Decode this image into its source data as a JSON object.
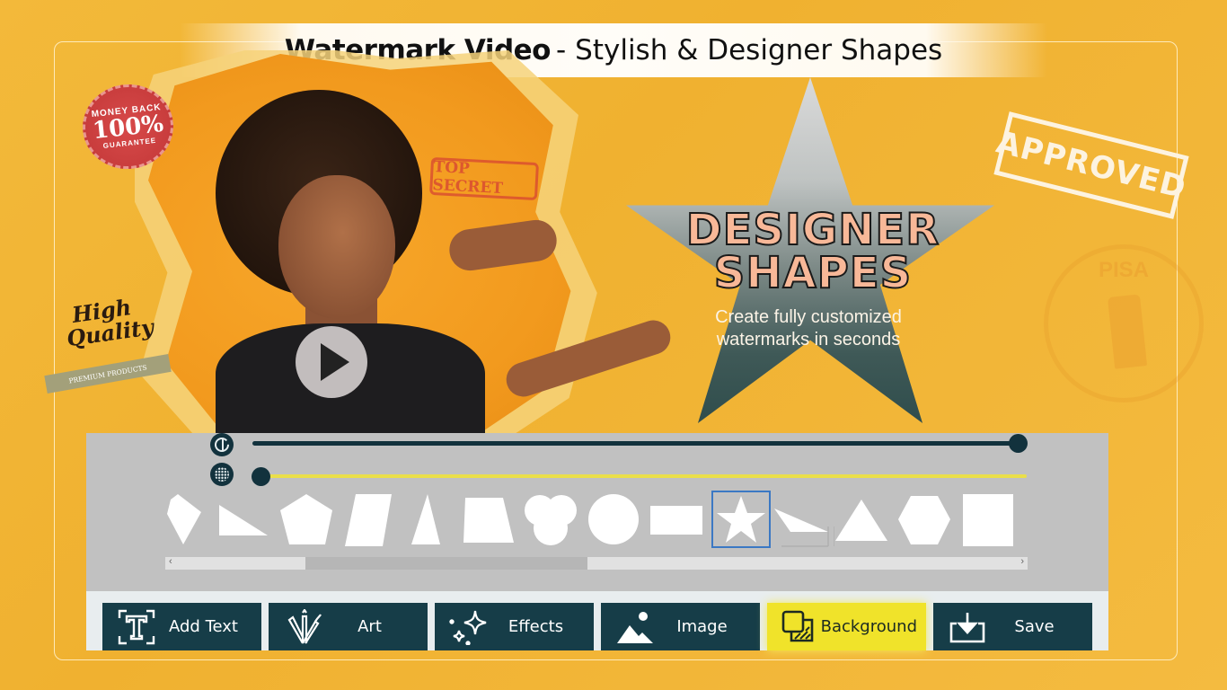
{
  "banner": {
    "app_name": "Watermark Video",
    "separator": "-",
    "tagline": "Stylish & Designer Shapes"
  },
  "stamps": {
    "money_back_top": "MONEY BACK",
    "money_back_mid": "100%",
    "money_back_bottom": "GUARANTEE",
    "top_secret": "TOP SECRET",
    "approved": "APPROVED",
    "pisa": "PISA",
    "high_quality_line1": "High",
    "high_quality_line2": "Quality",
    "premium_ribbon": "PREMIUM PRODUCTS"
  },
  "hero": {
    "headline_line1": "DESIGNER",
    "headline_line2": "SHAPES",
    "sub_line1": "Create fully customized",
    "sub_line2": "watermarks in seconds",
    "play_icon": "play-icon"
  },
  "sliders": [
    {
      "name": "opacity",
      "icon": "opacity-icon",
      "value": 1.0,
      "color": "#12323d"
    },
    {
      "name": "pattern-density",
      "icon": "halftone-grid-icon",
      "value": 0.0,
      "color": "#eadf4a"
    }
  ],
  "shapes": [
    {
      "name": "kite",
      "selected": false
    },
    {
      "name": "right-triangle",
      "selected": false
    },
    {
      "name": "pentagon",
      "selected": false
    },
    {
      "name": "parallelogram",
      "selected": false
    },
    {
      "name": "tall-triangle",
      "selected": false
    },
    {
      "name": "trapezoid",
      "selected": false
    },
    {
      "name": "trefoil",
      "selected": false
    },
    {
      "name": "circle",
      "selected": false
    },
    {
      "name": "rectangle",
      "selected": false
    },
    {
      "name": "star",
      "selected": true
    },
    {
      "name": "skewed-triangle",
      "selected": false
    },
    {
      "name": "triangle",
      "selected": false
    },
    {
      "name": "hexagon",
      "selected": false
    },
    {
      "name": "square",
      "selected": false
    }
  ],
  "scrollbar": {
    "left_arrow": "‹",
    "right_arrow": "›"
  },
  "toolbar": {
    "buttons": [
      {
        "label": "Add Text",
        "icon": "add-text-icon",
        "active": false
      },
      {
        "label": "Art",
        "icon": "art-brushes-icon",
        "active": false
      },
      {
        "label": "Effects",
        "icon": "sparkles-icon",
        "active": false
      },
      {
        "label": "Image",
        "icon": "image-mountain-icon",
        "active": false
      },
      {
        "label": "Background",
        "icon": "background-layers-icon",
        "active": true
      },
      {
        "label": "Save",
        "icon": "download-tray-icon",
        "active": false
      }
    ]
  },
  "colors": {
    "background": "#f0b130",
    "toolbar_button": "#163d48",
    "active_button": "#f0e32a",
    "panel": "#c1c1c1",
    "selection": "#3b78c4"
  }
}
